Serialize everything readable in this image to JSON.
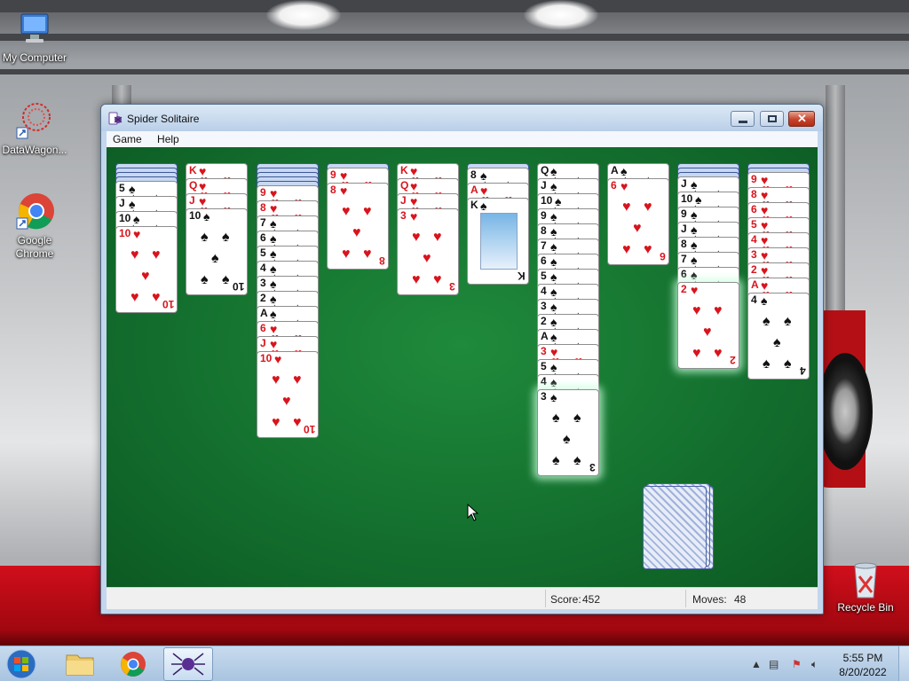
{
  "desktop": {
    "icons": [
      {
        "label": "My Computer",
        "icon": "computer-icon"
      },
      {
        "label": "DataWagon...",
        "icon": "datawagon-icon"
      },
      {
        "label": "Google Chrome",
        "icon": "chrome-icon"
      },
      {
        "label": "Recycle Bin",
        "icon": "recycle-bin-icon"
      }
    ]
  },
  "window": {
    "title": "Spider Solitaire",
    "menu": [
      "Game",
      "Help"
    ]
  },
  "status": {
    "score_label": "Score:",
    "score_value": "452",
    "moves_label": "Moves:",
    "moves_value": "48"
  },
  "tableau": [
    {
      "cards": [
        "back",
        "back",
        "back",
        "back",
        "5♠",
        "J♠",
        "10♠",
        "10♥"
      ]
    },
    {
      "cards": [
        "K♥",
        "Q♥",
        "J♥",
        "10♠"
      ]
    },
    {
      "cards": [
        "back",
        "back",
        "back",
        "back",
        "back",
        "9♥",
        "8♥",
        "7♠",
        "6♠",
        "5♠",
        "4♠",
        "3♠",
        "2♠",
        "A♠",
        "6♥",
        "J♥",
        "10♥"
      ]
    },
    {
      "cards": [
        "back",
        "9♥",
        "8♥"
      ]
    },
    {
      "cards": [
        "K♥",
        "Q♥",
        "J♥",
        "3♥"
      ]
    },
    {
      "cards": [
        "back",
        "8♠",
        "A♥",
        "K♠"
      ]
    },
    {
      "cards": [
        "Q♠",
        "J♠",
        "10♠",
        "9♠",
        "8♠",
        "7♠",
        "6♠",
        "5♠",
        "4♠",
        "3♠",
        "2♠",
        "A♠",
        "3♥",
        "5♠",
        "4♠",
        "3♠"
      ]
    },
    {
      "cards": [
        "A♠",
        "6♥"
      ]
    },
    {
      "cards": [
        "back",
        "back",
        "back",
        "J♠",
        "10♠",
        "9♠",
        "J♠",
        "8♠",
        "7♠",
        "6♠",
        "2♥"
      ]
    },
    {
      "cards": [
        "back",
        "back",
        "9♥",
        "8♥",
        "6♥",
        "5♥",
        "4♥",
        "3♥",
        "2♥",
        "A♥",
        "4♠"
      ]
    }
  ],
  "taskbar": {
    "clock_time": "5:55 PM",
    "clock_date": "8/20/2022"
  },
  "colors": {
    "felt": "#157330",
    "red_suit": "#d8141c",
    "taskbar": "#b6cfe8"
  }
}
